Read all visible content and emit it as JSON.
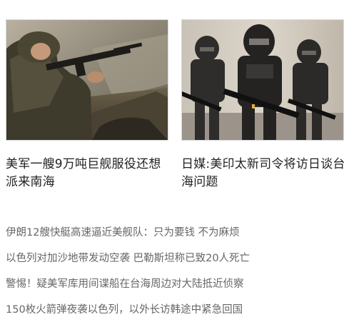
{
  "cards": [
    {
      "title": "美军一艘9万吨巨舰服役还想派来南海",
      "image": "soldier-firing-rifle-photo"
    },
    {
      "title": "日媒:美印太新司令将访日谈台海问题",
      "image": "armored-soldiers-illustration"
    }
  ],
  "news": [
    "伊朗12艘快艇高速逼近美舰队：只为要钱 不为麻烦",
    "以色列对加沙地带发动空袭 巴勒斯坦称已致20人死亡",
    "警惕！疑美军库用间谍船在台海周边对大陆抵近侦察",
    "150枚火箭弹夜袭以色列，以外长访韩途中紧急回国"
  ]
}
